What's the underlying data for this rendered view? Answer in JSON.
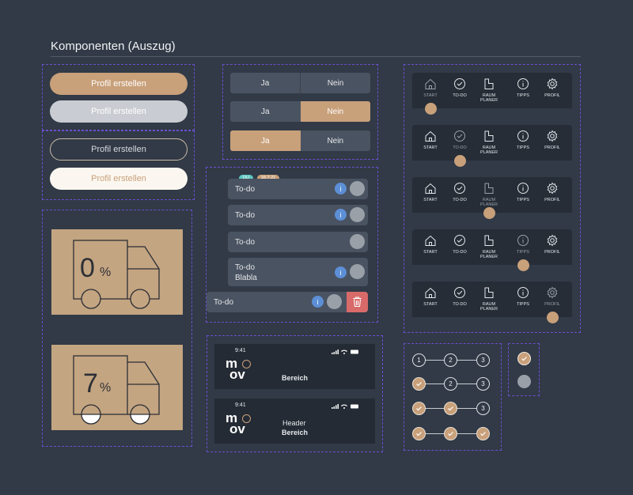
{
  "page": {
    "title": "Komponenten (Auszug)"
  },
  "buttons": {
    "label": "Profil erstellen"
  },
  "segmented": {
    "yes": "Ja",
    "no": "Nein"
  },
  "todos": {
    "tag_du": "DU",
    "tag_date": "16.7.21",
    "item_label": "To-do",
    "item_sub": "Blabla",
    "info_glyph": "i"
  },
  "nav": {
    "items": [
      {
        "label1": "START",
        "label2": "",
        "icon": "home-icon"
      },
      {
        "label1": "TO-DO",
        "label2": "",
        "icon": "check-circle-icon"
      },
      {
        "label1": "RAUM",
        "label2": "PLANER",
        "icon": "floorplan-icon"
      },
      {
        "label1": "TIPPS",
        "label2": "",
        "icon": "info-icon"
      },
      {
        "label1": "PROFIL",
        "label2": "",
        "icon": "gear-icon"
      }
    ],
    "active_index_per_row": [
      0,
      1,
      2,
      3,
      4
    ]
  },
  "progress_cards": [
    {
      "digit": "0",
      "unit": "%",
      "fill": 0.0
    },
    {
      "digit": "7",
      "unit": "%",
      "fill": 0.07
    }
  ],
  "phone_headers": [
    {
      "time": "9:41",
      "logo_top": "m",
      "logo_bottom": "ov",
      "header": "",
      "area": "Bereich"
    },
    {
      "time": "9:41",
      "logo_top": "m",
      "logo_bottom": "ov",
      "header": "Header",
      "area": "Bereich"
    }
  ],
  "stepper": {
    "labels": [
      "1",
      "2",
      "3"
    ],
    "done_counts": [
      0,
      1,
      2,
      3
    ]
  },
  "checkbox": {
    "states": [
      "checked",
      "unchecked"
    ]
  },
  "colors": {
    "background": "#313a46",
    "accent": "#c8a07a",
    "panel": "#4a5361",
    "dash": "#6b4fd0",
    "delete": "#d86a6a",
    "info": "#5c8fd6"
  }
}
